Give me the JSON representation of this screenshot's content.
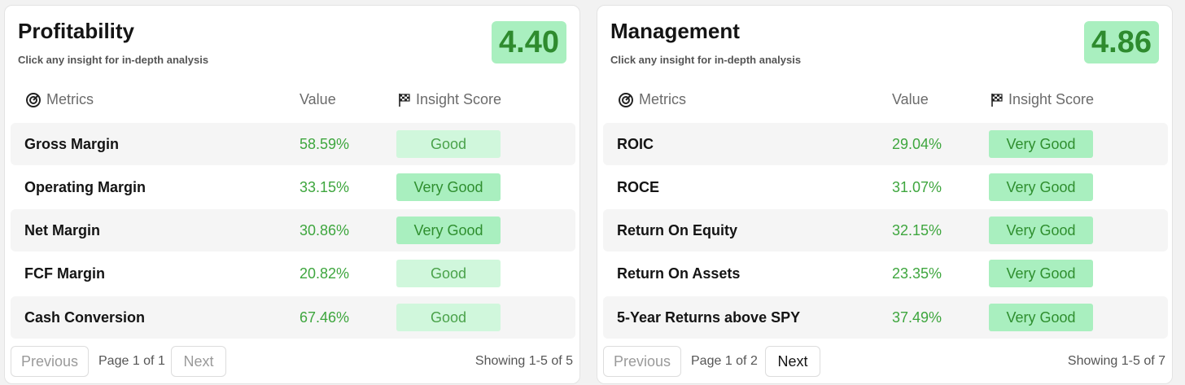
{
  "colors": {
    "good_bg": "#d0f7dc",
    "very_good_bg": "#a9efbf",
    "value_green": "#3ea63e",
    "score_green": "#2e8b2e"
  },
  "icons": {
    "metrics": "radar-icon",
    "insight": "checkered-flag-icon"
  },
  "cards": [
    {
      "title": "Profitability",
      "subtitle": "Click any insight for in-depth analysis",
      "score": "4.40",
      "headers": {
        "metrics": "Metrics",
        "value": "Value",
        "insight": "Insight Score"
      },
      "rows": [
        {
          "name": "Gross Margin",
          "value": "58.59%",
          "insight": "Good"
        },
        {
          "name": "Operating Margin",
          "value": "33.15%",
          "insight": "Very Good"
        },
        {
          "name": "Net Margin",
          "value": "30.86%",
          "insight": "Very Good"
        },
        {
          "name": "FCF Margin",
          "value": "20.82%",
          "insight": "Good"
        },
        {
          "name": "Cash Conversion",
          "value": "67.46%",
          "insight": "Good"
        }
      ],
      "pagination": {
        "previous": "Previous",
        "page": "Page 1 of 1",
        "next": "Next",
        "next_enabled": false,
        "showing": "Showing 1-5 of 5"
      }
    },
    {
      "title": "Management",
      "subtitle": "Click any insight for in-depth analysis",
      "score": "4.86",
      "headers": {
        "metrics": "Metrics",
        "value": "Value",
        "insight": "Insight Score"
      },
      "rows": [
        {
          "name": "ROIC",
          "value": "29.04%",
          "insight": "Very Good"
        },
        {
          "name": "ROCE",
          "value": "31.07%",
          "insight": "Very Good"
        },
        {
          "name": "Return On Equity",
          "value": "32.15%",
          "insight": "Very Good"
        },
        {
          "name": "Return On Assets",
          "value": "23.35%",
          "insight": "Very Good"
        },
        {
          "name": "5-Year Returns above SPY",
          "value": "37.49%",
          "insight": "Very Good"
        }
      ],
      "pagination": {
        "previous": "Previous",
        "page": "Page 1 of 2",
        "next": "Next",
        "next_enabled": true,
        "showing": "Showing 1-5 of 7"
      }
    }
  ]
}
